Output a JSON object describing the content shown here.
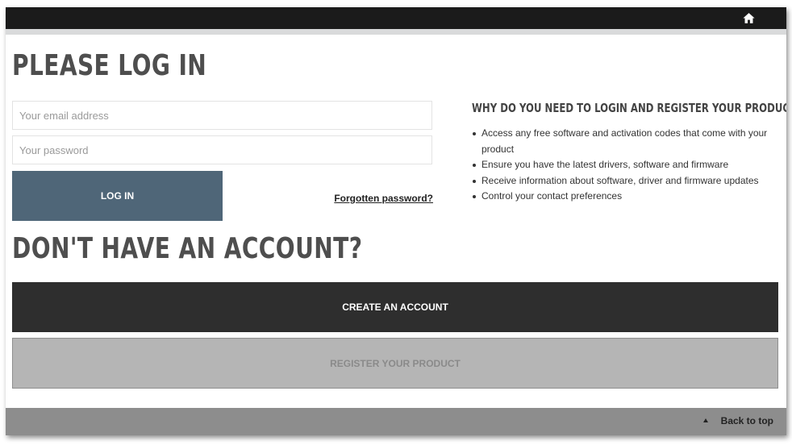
{
  "header": {
    "home_icon": "home-icon"
  },
  "login": {
    "title": "PLEASE LOG IN",
    "email_placeholder": "Your email address",
    "password_placeholder": "Your password",
    "login_button": "LOG IN",
    "forgot_link": "Forgotten password?"
  },
  "info": {
    "title": "WHY DO YOU NEED TO LOGIN AND REGISTER YOUR PRODUCT?",
    "items": [
      "Access any free software and activation codes that come with your product",
      "Ensure you have the latest drivers, software and firmware",
      "Receive information about software, driver and firmware updates",
      "Control your contact preferences"
    ]
  },
  "signup": {
    "title": "DON'T HAVE AN ACCOUNT?",
    "create_button": "CREATE AN ACCOUNT",
    "register_button": "REGISTER YOUR PRODUCT"
  },
  "footer": {
    "back_to_top": "Back to top"
  },
  "colors": {
    "topbar": "#1b1b1b",
    "login_button": "#4f6678",
    "create_button": "#2e2e2e",
    "register_button": "#b5b5b5",
    "footer": "#8d8d8d"
  }
}
